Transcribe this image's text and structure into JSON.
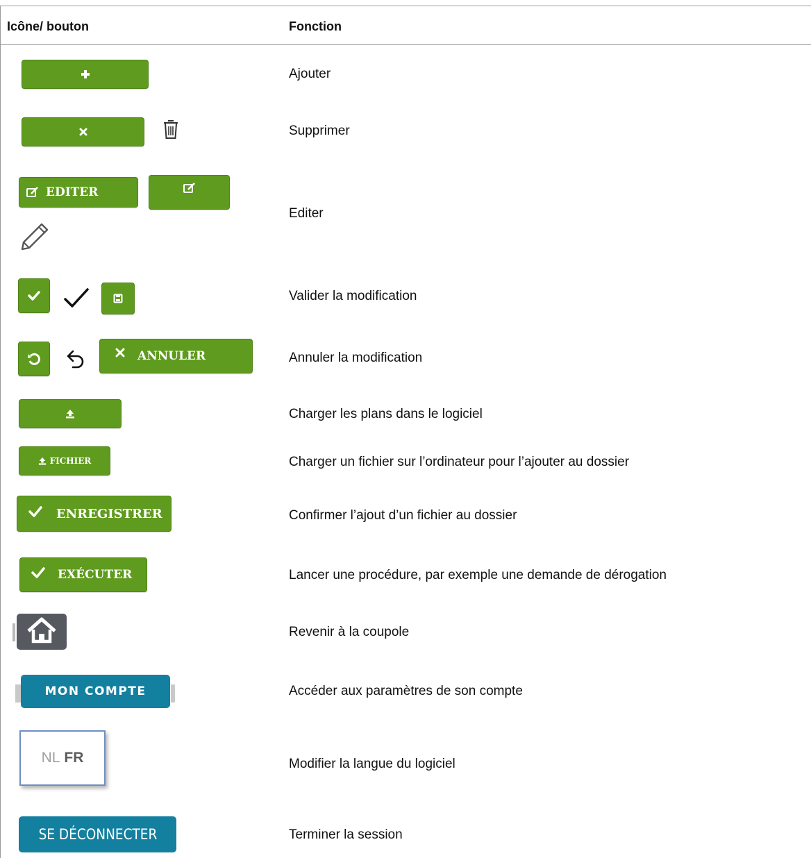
{
  "header": {
    "col_icon": "Icône/ bouton",
    "col_function": "Fonction"
  },
  "rows": [
    {
      "function": "Ajouter"
    },
    {
      "function": "Supprimer"
    },
    {
      "function": "Editer",
      "buttons": {
        "edit_label": "EDITER"
      }
    },
    {
      "function": "Valider la modification"
    },
    {
      "function": "Annuler la modification",
      "buttons": {
        "cancel_label": "ANNULER"
      }
    },
    {
      "function": "Charger les plans dans le logiciel"
    },
    {
      "function": "Charger un fichier sur l’ordinateur pour l’ajouter au dossier",
      "buttons": {
        "file_label": "FICHIER"
      }
    },
    {
      "function": "Confirmer l’ajout d’un fichier au dossier",
      "buttons": {
        "save_label": "ENREGISTRER"
      }
    },
    {
      "function": "Lancer une procédure, par exemple une demande de dérogation",
      "buttons": {
        "run_label": "EXÉCUTER"
      }
    },
    {
      "function": "Revenir à la coupole"
    },
    {
      "function": "Accéder aux paramètres de son compte",
      "buttons": {
        "account_label": "MON COMPTE"
      }
    },
    {
      "function": "Modifier la langue du logiciel",
      "buttons": {
        "lang_nl": "NL",
        "lang_fr": "FR"
      }
    },
    {
      "function": "Terminer la session",
      "buttons": {
        "logout_label": "SE DÉCONNECTER"
      }
    }
  ],
  "colors": {
    "green_button": "#5f9b1e",
    "blue_button": "#13809f",
    "home_tile": "#565a60"
  }
}
